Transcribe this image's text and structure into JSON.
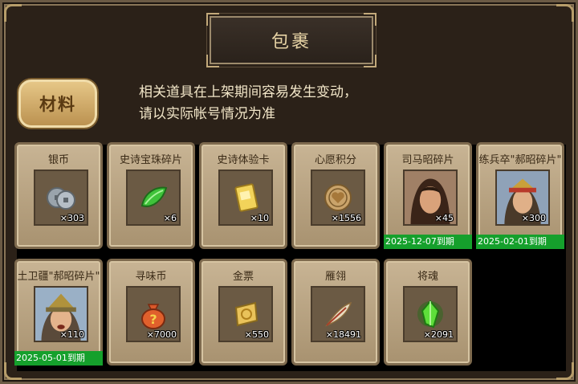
{
  "window": {
    "title": "包裹"
  },
  "tab": {
    "label": "材料"
  },
  "notice": {
    "line1": "相关道具在上架期间容易发生变动，",
    "line2": "请以实际帐号情况为准"
  },
  "items": [
    {
      "name": "银币",
      "count": "×303",
      "icon": "coins-icon"
    },
    {
      "name": "史诗宝珠碎片",
      "count": "×6",
      "icon": "green-leaf-gem-icon"
    },
    {
      "name": "史诗体验卡",
      "count": "×10",
      "icon": "gold-card-icon"
    },
    {
      "name": "心愿积分",
      "count": "×1556",
      "icon": "heart-coin-icon"
    },
    {
      "name": "司马昭碎片",
      "count": "×45",
      "icon": "hero-portrait-icon",
      "expiry": "2025-12-07到期"
    },
    {
      "name": "练兵卒\"郝昭碎片\"",
      "count": "×300",
      "icon": "hero-portrait-icon",
      "expiry": "2025-02-01到期"
    },
    {
      "name": "土卫疆\"郝昭碎片\"",
      "count": "×110",
      "icon": "hero-portrait-icon",
      "expiry": "2025-05-01到期"
    },
    {
      "name": "寻味币",
      "count": "×7000",
      "icon": "mystery-bag-icon"
    },
    {
      "name": "金票",
      "count": "×550",
      "icon": "gold-ticket-icon"
    },
    {
      "name": "雁翎",
      "count": "×18491",
      "icon": "feather-icon"
    },
    {
      "name": "将魂",
      "count": "×2091",
      "icon": "green-crystal-icon"
    }
  ]
}
